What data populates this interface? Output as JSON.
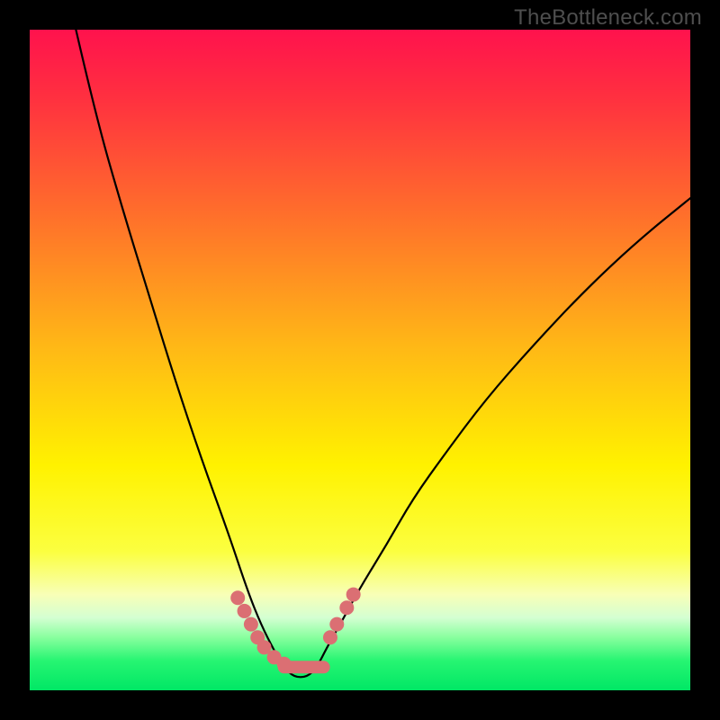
{
  "watermark": "TheBottleneck.com",
  "chart_data": {
    "type": "line",
    "title": "",
    "xlabel": "",
    "ylabel": "",
    "xlim": [
      0,
      100
    ],
    "ylim": [
      0,
      100
    ],
    "grid": false,
    "legend": false,
    "series": [
      {
        "name": "bottleneck-curve",
        "x": [
          7,
          10,
          14,
          18,
          22,
          26,
          30,
          33,
          35,
          37,
          38.5,
          40,
          42,
          43.5,
          45,
          47,
          50,
          54,
          58,
          63,
          69,
          76,
          84,
          92,
          100
        ],
        "y": [
          100,
          87,
          73,
          60,
          47,
          35,
          24,
          15,
          10,
          6,
          3.5,
          2,
          2,
          3.5,
          6.5,
          10,
          15.5,
          22,
          29,
          36,
          44,
          52,
          60.5,
          68,
          74.5
        ]
      },
      {
        "name": "marker-dots-left",
        "x": [
          31.5,
          32.5,
          33.5,
          34.5,
          35.5,
          37.0,
          38.5
        ],
        "y": [
          14,
          12,
          10,
          8,
          6.5,
          5,
          4
        ]
      },
      {
        "name": "marker-dots-right",
        "x": [
          45.5,
          46.5,
          48.0,
          49.0
        ],
        "y": [
          8,
          10,
          12.5,
          14.5
        ]
      },
      {
        "name": "bottom-segment",
        "x": [
          38.5,
          44.5
        ],
        "y": [
          3.5,
          3.5
        ]
      }
    ],
    "gradient_stops": [
      {
        "offset": 0.0,
        "color": "#ff124d"
      },
      {
        "offset": 0.1,
        "color": "#ff2f40"
      },
      {
        "offset": 0.28,
        "color": "#ff6f2b"
      },
      {
        "offset": 0.48,
        "color": "#ffb816"
      },
      {
        "offset": 0.66,
        "color": "#fff200"
      },
      {
        "offset": 0.79,
        "color": "#fbff40"
      },
      {
        "offset": 0.855,
        "color": "#f8ffb7"
      },
      {
        "offset": 0.89,
        "color": "#d4ffd2"
      },
      {
        "offset": 0.92,
        "color": "#88ff9e"
      },
      {
        "offset": 0.955,
        "color": "#27f572"
      },
      {
        "offset": 1.0,
        "color": "#00e765"
      }
    ]
  }
}
